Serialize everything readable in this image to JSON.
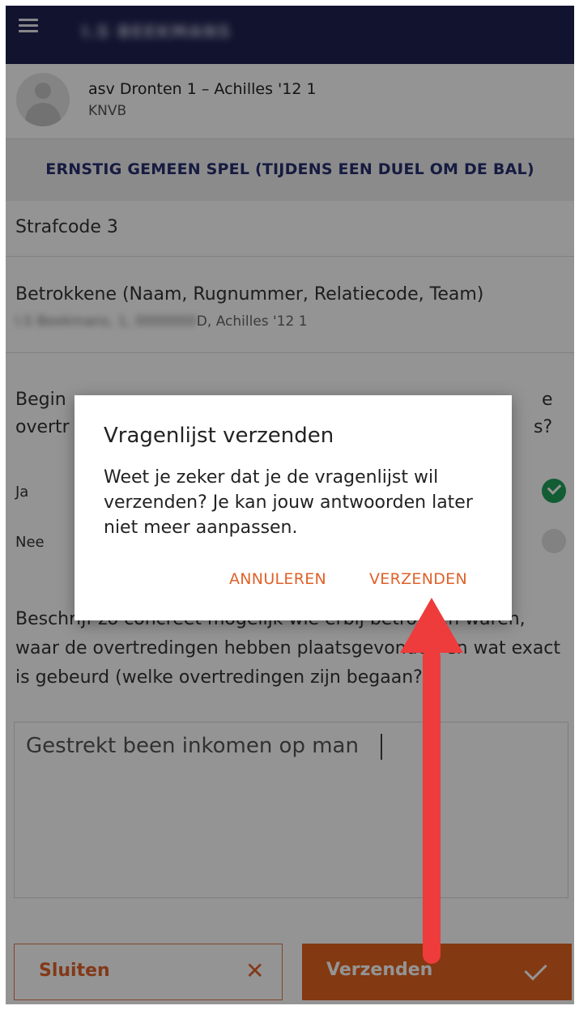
{
  "header": {
    "title": "I.S BEEKMANS"
  },
  "match": {
    "title": "asv Dronten 1 – Achilles '12 1",
    "subtitle": "KNVB"
  },
  "category": {
    "label": "ERNSTIG GEMEEN SPEL (TIJDENS EEN DUEL OM DE BAL)"
  },
  "strafcode": {
    "label": "Strafcode 3"
  },
  "betrokkene": {
    "label": "Betrokkene (Naam, Rugnummer, Relatiecode, Team)",
    "value_hidden": "I.S Beekmans, 1, 0000000",
    "value_visible": "D, Achilles '12 1"
  },
  "question": {
    "text_start": "Begin",
    "text_line2_start": "overtr",
    "text_end_1": "e",
    "text_end_2": "s?",
    "answers": [
      {
        "label": "Ja",
        "selected": true
      },
      {
        "label": "Nee",
        "selected": false
      }
    ]
  },
  "describe": {
    "label": "Beschrijf zo concreet mogelijk wie erbij betrokken waren, waar de overtredingen hebben plaatsgevonden en wat exact is gebeurd (welke overtredingen zijn begaan?)",
    "value": "Gestrekt been inkomen op man"
  },
  "buttons": {
    "close": "Sluiten",
    "send": "Verzenden"
  },
  "dialog": {
    "title": "Vragenlijst verzenden",
    "message": "Weet je zeker dat je de vragenlijst wil verzenden? Je kan jouw antwoorden later niet meer aanpassen.",
    "cancel": "ANNULEREN",
    "confirm": "VERZENDEN"
  },
  "colors": {
    "header_bg": "#1f2251",
    "accent": "#e2631e",
    "category_text": "#27306e",
    "check_green": "#1fa05a",
    "annotation_arrow": "#ee3b3b"
  }
}
